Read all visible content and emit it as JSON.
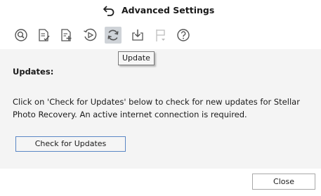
{
  "window": {
    "title": "Advanced Settings"
  },
  "toolbar": {
    "buttons": [
      {
        "icon": "search-drive-icon"
      },
      {
        "icon": "document-check-icon"
      },
      {
        "icon": "document-add-icon"
      },
      {
        "icon": "resume-recovery-icon"
      },
      {
        "icon": "update-refresh-icon",
        "active": true
      },
      {
        "icon": "save-download-icon"
      },
      {
        "icon": "flag-dropdown-icon"
      },
      {
        "icon": "help-icon"
      }
    ],
    "tooltip": "Update"
  },
  "content": {
    "heading": "Updates:",
    "description": "Click on 'Check for Updates' below to check for new updates for Stellar Photo Recovery. An active internet connection is required.",
    "check_button_label": "Check for Updates"
  },
  "footer": {
    "close_label": "Close"
  },
  "colors": {
    "panel_bg": "#f4f4f4",
    "active_tool_bg": "#cfd3d8",
    "button_focus_border": "#5a87c5"
  }
}
